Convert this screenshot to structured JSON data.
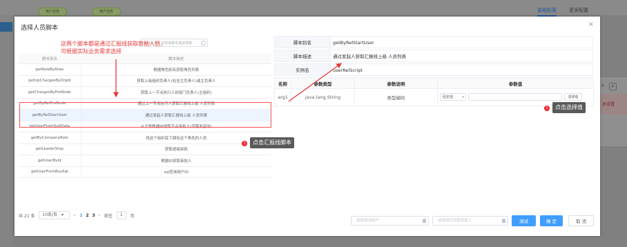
{
  "background": {
    "chips": [
      "用户任务",
      "用户任务"
    ],
    "tabs": [
      "基础配置",
      "更多配置"
    ],
    "right_panel": {
      "num": "4",
      "plus": "+",
      "status": "员设置"
    }
  },
  "dialog": {
    "title": "选择人员脚本",
    "close": "×",
    "search_placeholder": "请输入脚本名称或脚本描述搜索",
    "table": {
      "headers": [
        "脚本别名",
        "脚本描述"
      ],
      "rows": [
        {
          "alias": "getRoleByAlias",
          "desc": "根据角色别名获取角色列表"
        },
        {
          "alias": "getUpChargesByOrgId",
          "desc": "获取上级组织负责人(包含主负责人)或主负责人"
        },
        {
          "alias": "getChargesByPreNode",
          "desc": "获取上一节点执行人的部门负责人(主组织)"
        },
        {
          "alias": "getByRelPreNode",
          "desc": "通过上一节点执行人获取汇报线上级 人员列表"
        },
        {
          "alias": "getByRelStartUser",
          "desc": "通过发起人获取汇报线上级 人员列表"
        },
        {
          "alias": "getUserFromSubData",
          "desc": "从子表数据中提取节点审批人(流程发起时)"
        },
        {
          "alias": "getByCompanyRole",
          "desc": "找这个组织底下拥有这个角色的人员"
        },
        {
          "alias": "getLeaderStep",
          "desc": "获取逐级审批"
        },
        {
          "alias": "getUserById",
          "desc": "根据ID获取审批人"
        },
        {
          "alias": "getUserFromBusSql",
          "desc": "sql查询用户ID"
        }
      ]
    },
    "pager": {
      "total": "共 21 条",
      "page_size": "10条/页",
      "pages": [
        "1",
        "2",
        "3"
      ],
      "current_page": "1",
      "goto_label": "前往",
      "goto_value": "1",
      "page_suffix": "页",
      "prev": "‹",
      "next": "›"
    },
    "detail": {
      "script_name_label": "脚本别名",
      "script_name": "getByRelStartUser",
      "script_desc_label": "脚本描述",
      "script_desc": "通过发起人获取汇报线上级 人员列表",
      "instance_label": "实例名",
      "instance": "userRelScript"
    },
    "params": {
      "headers": [
        "名称",
        "参数类型",
        "参数说明",
        "参数值"
      ],
      "row": {
        "name": "arg1",
        "type": "java.lang.String",
        "desc": "类型编码",
        "value_mode": "固定值",
        "select_button": "选择值"
      }
    },
    "footer": {
      "test_user_placeholder": "选择测试用户",
      "test_starter_placeholder": "选择测试流程发起人",
      "test_button": "测试",
      "ok_button": "确 定",
      "cancel_button": "取 消"
    }
  },
  "annotations": {
    "note_line1": "这两个脚本都是通过汇报线获取审批人员，",
    "note_line2": "可根据实际业务需求选择",
    "step1_num": "1",
    "step1_text": "点击汇报线脚本",
    "step2_num": "2",
    "step2_text": "点击选择值",
    "annotation_color": "#e53935",
    "primary_color": "#409eff"
  }
}
